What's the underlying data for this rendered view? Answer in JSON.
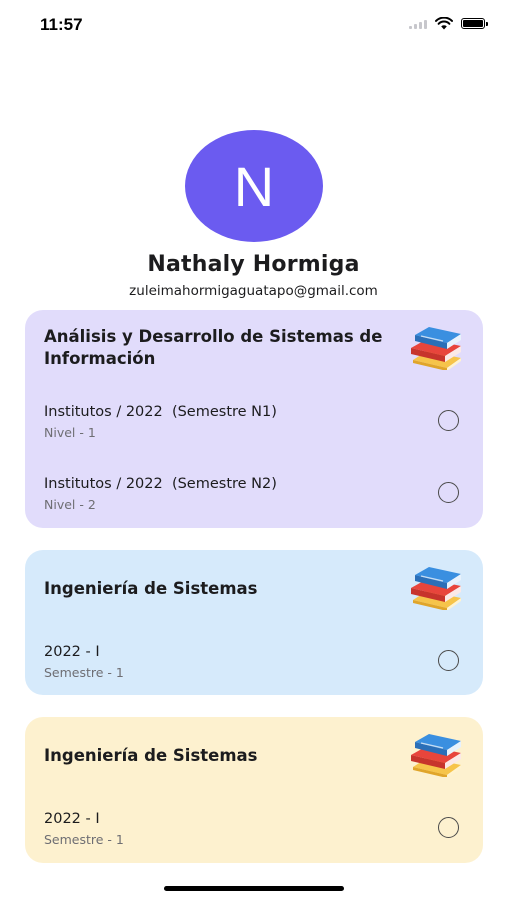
{
  "status_bar": {
    "time": "11:57"
  },
  "profile": {
    "initial": "N",
    "name": "Nathaly Hormiga",
    "email": "zuleimahormigaguatapo@gmail.com"
  },
  "cards": [
    {
      "title": "Análisis y Desarrollo de Sistemas de Información",
      "color": "#e1dcfb",
      "options": [
        {
          "title": "Institutos / 2022  (Semestre N1)",
          "subtitle": "Nivel - 1"
        },
        {
          "title": "Institutos / 2022  (Semestre N2)",
          "subtitle": "Nivel - 2"
        }
      ]
    },
    {
      "title": "Ingeniería de Sistemas",
      "color": "#d6eafb",
      "options": [
        {
          "title": "2022 - I",
          "subtitle": "Semestre - 1"
        }
      ]
    },
    {
      "title": "Ingeniería de Sistemas",
      "color": "#fdf1cf",
      "options": [
        {
          "title": "2022 - I",
          "subtitle": "Semestre - 1"
        }
      ]
    }
  ],
  "icons": {
    "card_icon": "books-icon",
    "option_control": "radio-button-icon"
  }
}
